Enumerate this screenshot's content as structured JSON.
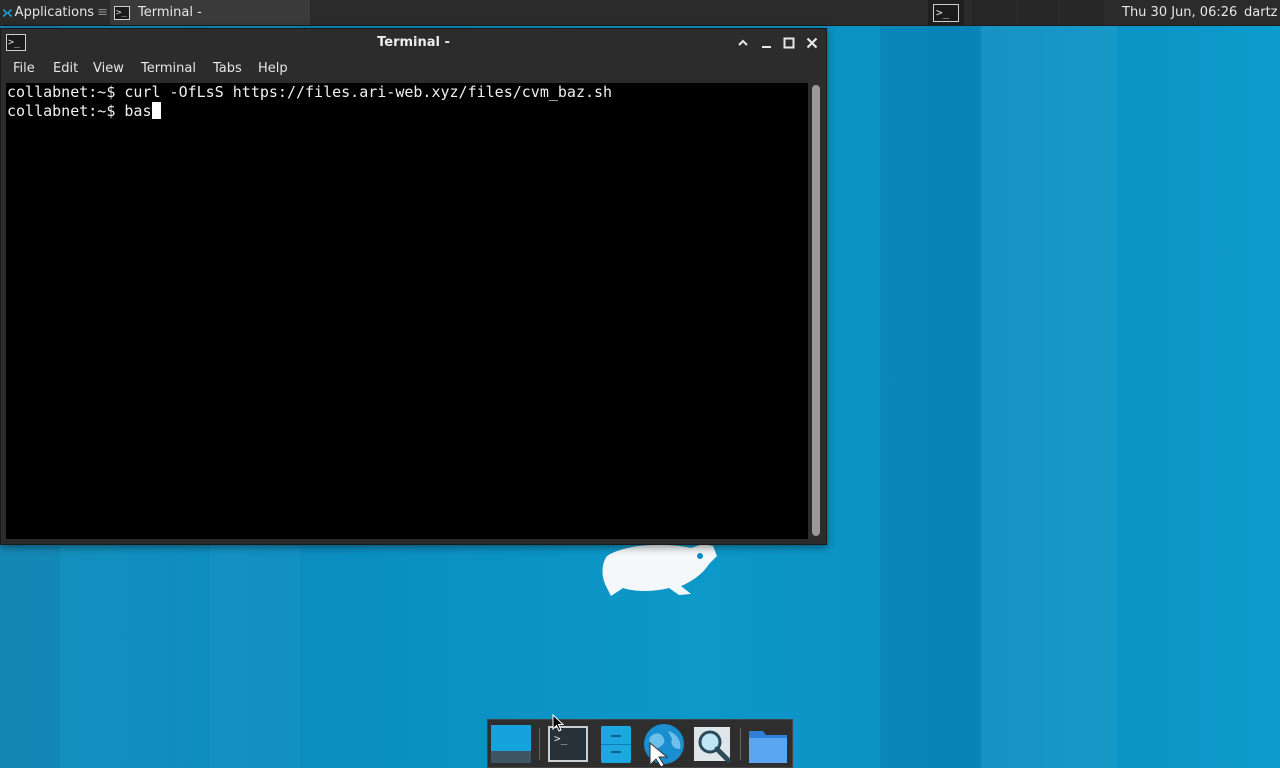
{
  "top_panel": {
    "applications_label": "Applications",
    "applications_sep": "≡",
    "taskbar_terminal_label": "Terminal -",
    "clock": "Thu 30 Jun, 06:26",
    "user": "dartz",
    "terminal_glyph": ">_"
  },
  "window": {
    "title": "Terminal -",
    "menu": [
      "File",
      "Edit",
      "View",
      "Terminal",
      "Tabs",
      "Help"
    ]
  },
  "terminal": {
    "lines": [
      {
        "prompt": "collabnet:~$ ",
        "command": "curl -OfLsS https://files.ari-web.xyz/files/cvm_baz.sh"
      },
      {
        "prompt": "collabnet:~$ ",
        "command": "bas"
      }
    ]
  },
  "dock": {
    "items": [
      "show-desktop",
      "terminal",
      "file-manager",
      "web-browser",
      "app-finder",
      "home-folder"
    ],
    "terminal_glyph": ">_"
  },
  "colors": {
    "desktop": "#0a8dc0",
    "panel": "#2b2b2b",
    "terminal_bg": "#000000",
    "terminal_fg": "#f0f0f0"
  }
}
